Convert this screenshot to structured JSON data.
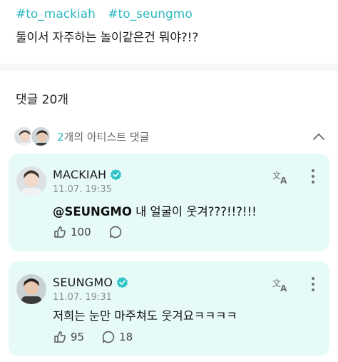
{
  "post": {
    "tags": [
      "#to_mackiah",
      "#to_seungmo"
    ],
    "text": "둘이서 자주하는 놀이같은건 뭐야?!?"
  },
  "comments_section": {
    "title": "댓글 20개",
    "artist_count": "2",
    "artist_label": "개의 아티스트 댓글"
  },
  "comments": [
    {
      "author": "MACKIAH",
      "time": "11.07. 19:35",
      "mention": "@SEUNGMO",
      "text": " 내 얼굴이 웃겨???!!?!!!",
      "likes": "100",
      "replies": ""
    },
    {
      "author": "SEUNGMO",
      "time": "11.07. 19:31",
      "mention": "",
      "text": "저희는 눈만 마주쳐도 웃겨요ㅋㅋㅋㅋ",
      "likes": "95",
      "replies": "18"
    }
  ],
  "colors": {
    "accent": "#2fb9bf",
    "card_bg": "#e6faf8",
    "verified": "#2ec4c7"
  },
  "icons": [
    "verified-badge-icon",
    "translate-icon",
    "more-options-icon",
    "like-icon",
    "reply-icon",
    "chevron-up-icon"
  ]
}
